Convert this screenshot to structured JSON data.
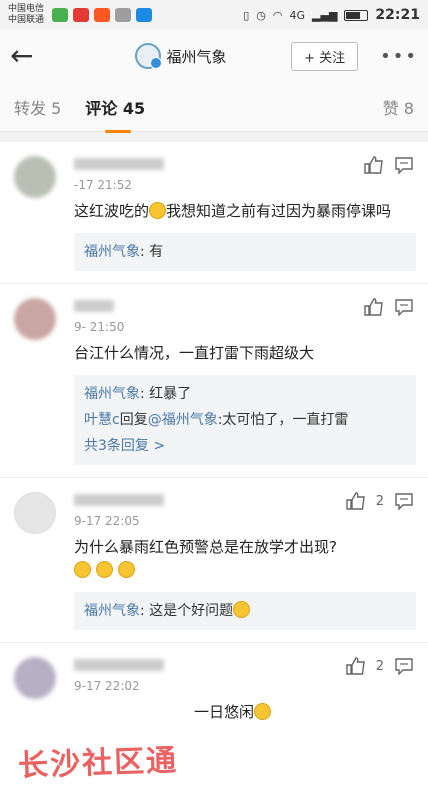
{
  "status_bar": {
    "carrier1": "中国电信",
    "carrier2": "中国联通",
    "network1": "4G",
    "time": "22:21"
  },
  "header": {
    "back_icon": "arrow-left-icon",
    "account_name": "福州气象",
    "follow_label": "+ 关注",
    "more_label": "•••"
  },
  "tabs": {
    "repost": "转发 5",
    "comments": "评论 45",
    "likes": "赞 8"
  },
  "comments": [
    {
      "time": "-17 21:52",
      "text_before": "这红波吃的",
      "text_after": "我想知道之前有过因为暴雨停课吗",
      "like_count": "",
      "replies": [
        {
          "user": "福州气象",
          "sep": ": ",
          "text": "有"
        }
      ]
    },
    {
      "time": "9-    21:50",
      "text": "台江什么情况，一直打雷下雨超级大",
      "like_count": "",
      "replies": [
        {
          "user": "福州气象",
          "sep": ": ",
          "text": "红暴了"
        },
        {
          "user": "叶慧c",
          "mid": "回复",
          "user2": "@福州气象",
          "text": ":太可怕了，一直打雷"
        }
      ],
      "more_replies": "共3条回复 >"
    },
    {
      "time": "9-17 22:05",
      "text": "为什么暴雨红色预警总是在放学才出现?",
      "like_count": "2",
      "replies": [
        {
          "user": "福州气象",
          "sep": ": ",
          "text": "这是个好问题"
        }
      ]
    },
    {
      "time": "9-17 22:02",
      "text": "一日悠闲",
      "like_count": "2"
    }
  ],
  "watermark": "长沙社区通",
  "colors": {
    "accent": "#ff8200",
    "link": "#4a79a8"
  }
}
